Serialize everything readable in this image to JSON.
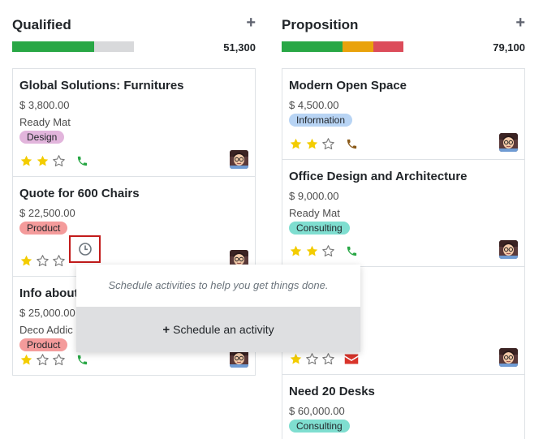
{
  "columns": [
    {
      "title": "Qualified",
      "add_label": "+",
      "total": "51,300",
      "progress": [
        {
          "color": "#28a745",
          "fraction": 0.67
        },
        {
          "color": "#d8d9db",
          "fraction": 0.33
        }
      ],
      "cards": [
        {
          "title": "Global Solutions: Furnitures",
          "amount": "$ 3,800.00",
          "company": "Ready Mat",
          "tag": "Design",
          "tag_color": "#e2b5dc",
          "stars": 2,
          "activity": "phone"
        },
        {
          "title": "Quote for 600 Chairs",
          "amount": "$ 22,500.00",
          "company": "",
          "tag": "Product",
          "tag_color": "#f49b9b",
          "stars": 1,
          "activity": "clock"
        },
        {
          "title": "Info about",
          "amount": "$ 25,000.00",
          "company": "Deco Addic",
          "tag": "Product",
          "tag_color": "#f49b9b",
          "stars": 1,
          "activity": "phone"
        }
      ]
    },
    {
      "title": "Proposition",
      "add_label": "+",
      "total": "79,100",
      "progress": [
        {
          "color": "#28a745",
          "fraction": 0.5
        },
        {
          "color": "#e9a20b",
          "fraction": 0.25
        },
        {
          "color": "#dc4c5a",
          "fraction": 0.25
        }
      ],
      "cards": [
        {
          "title": "Modern Open Space",
          "amount": "$ 4,500.00",
          "company": "",
          "tag": "Information",
          "tag_color": "#b8d4f4",
          "stars": 2,
          "activity": "phone-brown"
        },
        {
          "title": "Office Design and Architecture",
          "amount": "$ 9,000.00",
          "company": "Ready Mat",
          "tag": "Consulting",
          "tag_color": "#7fded0",
          "stars": 2,
          "activity": "phone"
        },
        {
          "title": "",
          "amount": "",
          "company": "",
          "tag": "",
          "tag_color": "",
          "stars": 1,
          "activity": "envelope"
        },
        {
          "title": "Need 20 Desks",
          "amount": "$ 60,000.00",
          "company": "",
          "tag": "Consulting",
          "tag_color": "#7fded0",
          "stars": 0,
          "activity": ""
        }
      ]
    }
  ],
  "popover": {
    "text": "Schedule activities to help you get things done.",
    "button_icon": "+",
    "button_label": "Schedule an activity"
  },
  "colors": {
    "star_filled": "#f3cc00",
    "star_empty": "#7a7a7a",
    "phone": "#28a745",
    "phone_brown": "#8a5a1a",
    "envelope": "#d9342b",
    "clock": "#6c757d"
  }
}
